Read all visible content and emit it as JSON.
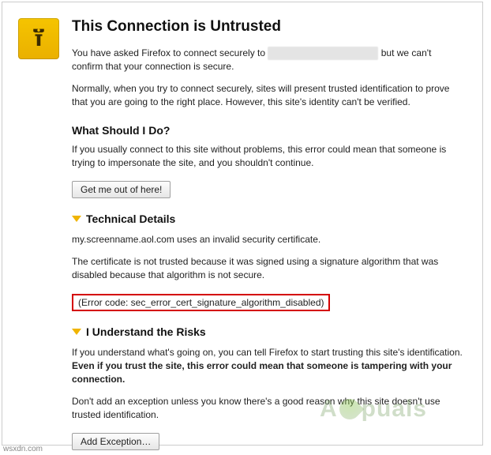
{
  "header": {
    "title": "This Connection is Untrusted"
  },
  "intro": {
    "p1_a": "You have asked Firefox to connect securely to ",
    "p1_redacted": "████████████████",
    "p1_b": " but we can't confirm that your connection is secure.",
    "p2": "Normally, when you try to connect securely, sites will present trusted identification to prove that you are going to the right place. However, this site's identity can't be verified."
  },
  "what": {
    "heading": "What Should I Do?",
    "p": "If you usually connect to this site without problems, this error could mean that someone is trying to impersonate the site, and you shouldn't continue.",
    "button": "Get me out of here!"
  },
  "tech": {
    "heading": "Technical Details",
    "p1": "my.screenname.aol.com uses an invalid security certificate.",
    "p2": "The certificate is not trusted because it was signed using a signature algorithm that was disabled because that algorithm is not secure.",
    "error_code": "(Error code: sec_error_cert_signature_algorithm_disabled)"
  },
  "risks": {
    "heading": "I Understand the Risks",
    "p1_a": "If you understand what's going on, you can tell Firefox to start trusting this site's identification. ",
    "p1_strong": "Even if you trust the site, this error could mean that someone is tampering with your connection.",
    "p2": "Don't add an exception unless you know there's a good reason why this site doesn't use trusted identification.",
    "button": "Add Exception…"
  },
  "watermark": {
    "before": "A",
    "after": "puals"
  },
  "footer_url": "wsxdn.com"
}
